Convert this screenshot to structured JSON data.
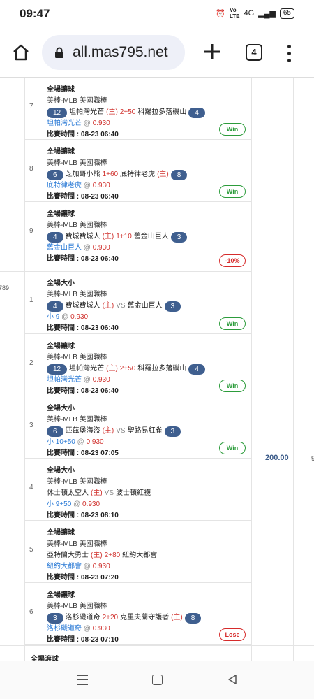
{
  "status": {
    "time": "09:47",
    "network": "4G",
    "battery": "65"
  },
  "browser": {
    "url": "all.mas795.net",
    "tab_count": "4"
  },
  "bet_id_fragment": "789",
  "stake_amount": "200.00",
  "edge_digit": "9",
  "bets": [
    {
      "idx": "7",
      "type": "全場讓球",
      "league": "美棒-MLB 美國職棒",
      "team_a_num": "12",
      "team_a": "坦帕灣光芒",
      "home": "(主)",
      "line": "2+50",
      "team_b": "科羅拉多落磯山",
      "team_b_num": "4",
      "pick": "坦帕灣光芒",
      "odds": "0.930",
      "time_label": "比賽時間 :",
      "time": "08-23 06:40",
      "result": "Win"
    },
    {
      "idx": "8",
      "type": "全場讓球",
      "league": "美棒-MLB 美國職棒",
      "team_a_num": "6",
      "team_a": "芝加哥小熊",
      "line": "1+60",
      "team_b": "底特律老虎",
      "home_b": "(主)",
      "team_b_num": "8",
      "pick": "底特律老虎",
      "odds": "0.930",
      "time_label": "比賽時間 :",
      "time": "08-23 06:40",
      "result": "Win"
    },
    {
      "idx": "9",
      "type": "全場讓球",
      "league": "美棒-MLB 美國職棒",
      "team_a_num": "4",
      "team_a": "費城費城人",
      "home": "(主)",
      "line": "1+10",
      "team_b": "舊金山巨人",
      "team_b_num": "3",
      "pick": "舊金山巨人",
      "odds": "0.930",
      "time_label": "比賽時間 :",
      "time": "08-23 06:40",
      "result": "-10%"
    },
    {
      "idx": "1",
      "type": "全場大小",
      "league": "美棒-MLB 美國職棒",
      "team_a_num": "4",
      "team_a": "費城費城人",
      "home": "(主)",
      "vs": "VS",
      "team_b": "舊金山巨人",
      "team_b_num": "3",
      "pick": "小 9",
      "odds": "0.930",
      "time_label": "比賽時間 :",
      "time": "08-23 06:40",
      "result": "Win"
    },
    {
      "idx": "2",
      "type": "全場讓球",
      "league": "美棒-MLB 美國職棒",
      "team_a_num": "12",
      "team_a": "坦帕灣光芒",
      "home": "(主)",
      "line": "2+50",
      "team_b": "科羅拉多落磯山",
      "team_b_num": "4",
      "pick": "坦帕灣光芒",
      "odds": "0.930",
      "time_label": "比賽時間 :",
      "time": "08-23 06:40",
      "result": "Win"
    },
    {
      "idx": "3",
      "type": "全場大小",
      "league": "美棒-MLB 美國職棒",
      "team_a_num": "6",
      "team_a": "匹茲堡海盜",
      "home": "(主)",
      "vs": "VS",
      "team_b": "聖路易紅雀",
      "team_b_num": "3",
      "pick": "小 10+50",
      "odds": "0.930",
      "time_label": "比賽時間 :",
      "time": "08-23 07:05",
      "result": "Win"
    },
    {
      "idx": "4",
      "type": "全場大小",
      "league": "美棒-MLB 美國職棒",
      "team_a": "休士頓太空人",
      "home": "(主)",
      "vs": "VS",
      "team_b": "波士頓紅襪",
      "pick": "小 9+50",
      "odds": "0.930",
      "time_label": "比賽時間 :",
      "time": "08-23 08:10",
      "result": ""
    },
    {
      "idx": "5",
      "type": "全場讓球",
      "league": "美棒-MLB 美國職棒",
      "team_a": "亞特蘭大勇士",
      "home": "(主)",
      "line": "2+80",
      "team_b": "紐約大都會",
      "pick": "紐約大都會",
      "odds": "0.930",
      "time_label": "比賽時間 :",
      "time": "08-23 07:20",
      "result": ""
    },
    {
      "idx": "6",
      "type": "全場讓球",
      "league": "美棒-MLB 美國職棒",
      "team_a_num": "3",
      "team_a": "洛杉磯道奇",
      "line": "2+20",
      "team_b": "克里夫蘭守護者",
      "home_b": "(主)",
      "team_b_num": "8",
      "pick": "洛杉磯道奇",
      "odds": "0.930",
      "time_label": "比賽時間 :",
      "time": "08-23 07:10",
      "result": "Lose"
    }
  ],
  "footer_label": "全場滾球"
}
